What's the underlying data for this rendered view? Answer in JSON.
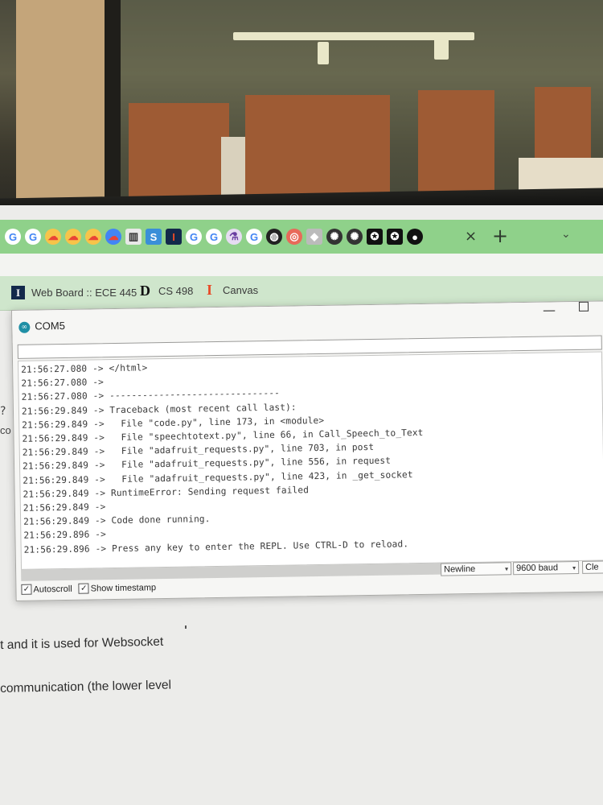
{
  "browser": {
    "tab_icons": [
      {
        "icon": "google-g-icon",
        "glyph": "G",
        "color": "#4285f4",
        "bg": "#ffffff"
      },
      {
        "icon": "google-g-icon",
        "glyph": "G",
        "color": "#4285f4",
        "bg": "#ffffff"
      },
      {
        "icon": "google-cloud-icon",
        "glyph": "☁",
        "color": "#ea4335",
        "bg": "#f7c44a"
      },
      {
        "icon": "google-cloud-icon",
        "glyph": "☁",
        "color": "#ea4335",
        "bg": "#f7c44a"
      },
      {
        "icon": "google-cloud-icon",
        "glyph": "☁",
        "color": "#ea4335",
        "bg": "#f7c44a"
      },
      {
        "icon": "google-cloud-icon",
        "glyph": "☁",
        "color": "#ea4335",
        "bg": "#4285f4"
      },
      {
        "icon": "book-icon",
        "glyph": "▥",
        "color": "#333333",
        "bg": "#e8e8e8"
      },
      {
        "icon": "s-app-icon",
        "glyph": "S",
        "color": "#ffffff",
        "bg": "#3a8fd8"
      },
      {
        "icon": "illinois-icon",
        "glyph": "I",
        "color": "#e84a27",
        "bg": "#13294b"
      },
      {
        "icon": "google-g-icon",
        "glyph": "G",
        "color": "#4285f4",
        "bg": "#ffffff"
      },
      {
        "icon": "google-g-icon",
        "glyph": "G",
        "color": "#4285f4",
        "bg": "#ffffff"
      },
      {
        "icon": "flask-icon",
        "glyph": "⚗",
        "color": "#6a3ea1",
        "bg": "#e6dcf2"
      },
      {
        "icon": "google-g-icon",
        "glyph": "G",
        "color": "#4285f4",
        "bg": "#ffffff"
      },
      {
        "icon": "globe-icon",
        "glyph": "◍",
        "color": "#ffffff",
        "bg": "#222222"
      },
      {
        "icon": "circle-app-icon",
        "glyph": "◎",
        "color": "#ffffff",
        "bg": "#e86a5a"
      },
      {
        "icon": "cube-icon",
        "glyph": "◆",
        "color": "#ffffff",
        "bg": "#bbbbbb"
      },
      {
        "icon": "chatgpt-icon",
        "glyph": "✺",
        "color": "#ffffff",
        "bg": "#333333"
      },
      {
        "icon": "chatgpt-icon",
        "glyph": "✺",
        "color": "#ffffff",
        "bg": "#333333"
      },
      {
        "icon": "star-app-icon",
        "glyph": "✪",
        "color": "#ffffff",
        "bg": "#111111"
      },
      {
        "icon": "star-app-icon",
        "glyph": "✪",
        "color": "#ffffff",
        "bg": "#111111"
      },
      {
        "icon": "github-icon",
        "glyph": "●",
        "color": "#ffffff",
        "bg": "#111111"
      }
    ],
    "close_tab": "×",
    "new_tab": "+",
    "bookmarks": [
      {
        "icon": "illinois-icon",
        "glyph": "I",
        "label": "Web Board :: ECE 445"
      },
      {
        "icon": "d-app-icon",
        "glyph": "D",
        "label": "CS 498"
      },
      {
        "icon": "canvas-icon",
        "glyph": "I",
        "label": "Canvas"
      }
    ]
  },
  "serial_monitor": {
    "title": "COM5",
    "send_value": "",
    "lines": [
      "21:56:27.080 -> </html>",
      "21:56:27.080 ->",
      "21:56:27.080 -> -------------------------------",
      "21:56:29.849 -> Traceback (most recent call last):",
      "21:56:29.849 ->   File \"code.py\", line 173, in <module>",
      "21:56:29.849 ->   File \"speechtotext.py\", line 66, in Call_Speech_to_Text",
      "21:56:29.849 ->   File \"adafruit_requests.py\", line 703, in post",
      "21:56:29.849 ->   File \"adafruit_requests.py\", line 556, in request",
      "21:56:29.849 ->   File \"adafruit_requests.py\", line 423, in _get_socket",
      "21:56:29.849 -> RuntimeError: Sending request failed",
      "21:56:29.849 ->",
      "21:56:29.849 -> Code done running.",
      "21:56:29.896 ->",
      "21:56:29.896 -> Press any key to enter the REPL. Use CTRL-D to reload."
    ],
    "line_ending": "Newline",
    "baud": "9600 baud",
    "clear_label": "Cle",
    "autoscroll_label": "Autoscroll",
    "timestamp_label": "Show timestamp",
    "autoscroll_checked": true,
    "timestamp_checked": true
  },
  "document": {
    "fragment_q": "?",
    "fragment_co": "co",
    "line1": "t and it is used for Websocket",
    "line2": "communication (the lower level"
  }
}
